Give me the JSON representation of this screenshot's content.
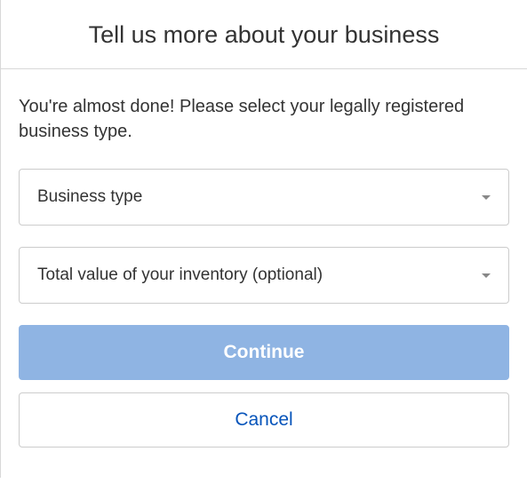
{
  "header": {
    "title": "Tell us more about your business"
  },
  "form": {
    "description": "You're almost done! Please select your legally registered business type.",
    "businessType": {
      "label": "Business type"
    },
    "inventoryValue": {
      "label": "Total value of your inventory (optional)"
    }
  },
  "actions": {
    "continue": "Continue",
    "cancel": "Cancel"
  }
}
